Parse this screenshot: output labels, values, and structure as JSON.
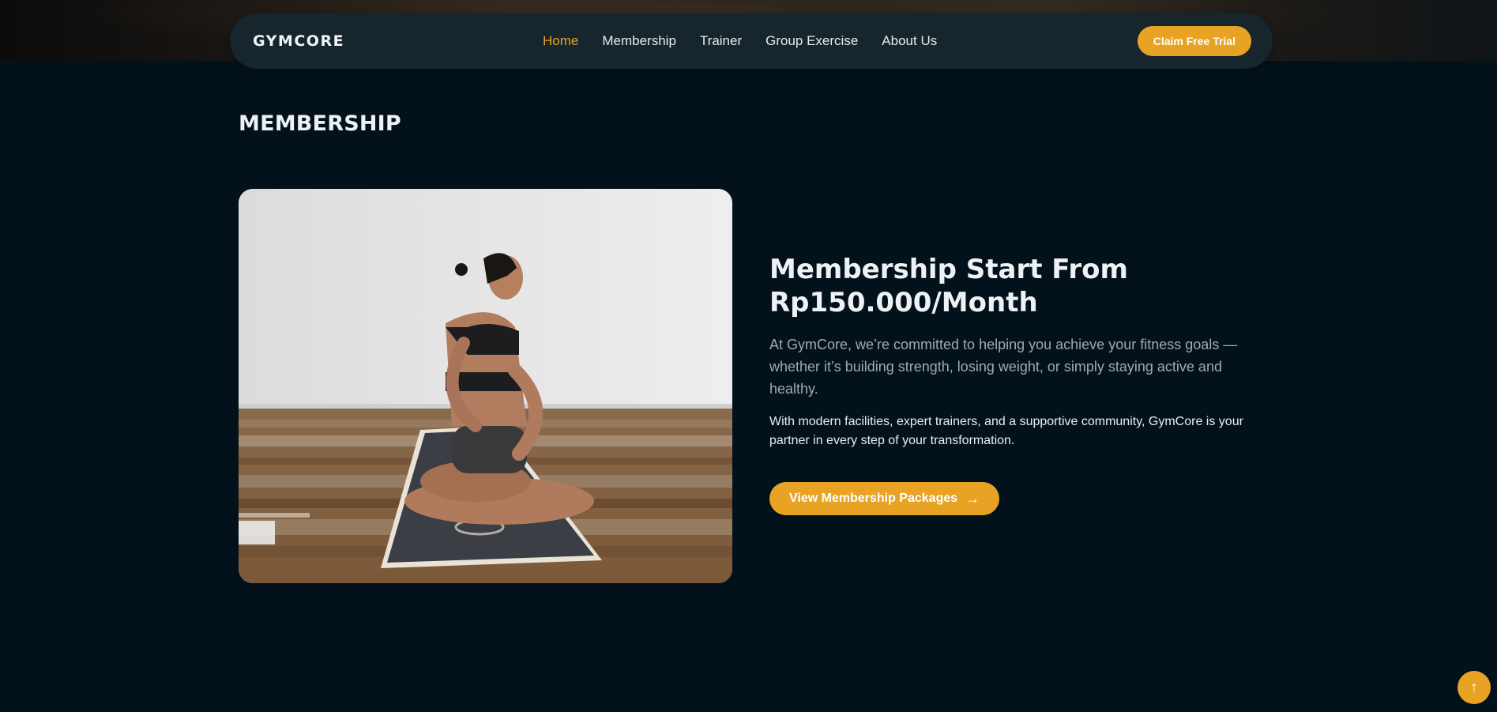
{
  "nav": {
    "brand": "GYMCORE",
    "links": [
      {
        "label": "Home",
        "active": true
      },
      {
        "label": "Membership",
        "active": false
      },
      {
        "label": "Trainer",
        "active": false
      },
      {
        "label": "Group Exercise",
        "active": false
      },
      {
        "label": "About Us",
        "active": false
      }
    ],
    "cta_label": "Claim Free Trial"
  },
  "section": {
    "title": "MEMBERSHIP",
    "headline": "Membership Start From Rp150.000/Month",
    "lead": "At GymCore, we’re committed to helping you achieve your fitness goals — whether it’s building strength, losing weight, or simply staying active and healthy.",
    "body": "With modern facilities, expert trainers, and a supportive community, GymCore is your partner in every step of your transformation.",
    "button_label": "View Membership Packages",
    "button_icon": "arrow-right-icon",
    "image_icon": "woman-yoga-photo"
  },
  "scroll_top_icon": "arrow-up-icon",
  "colors": {
    "accent": "#e8a325",
    "background": "#03121a",
    "navbar": "#17252d"
  }
}
